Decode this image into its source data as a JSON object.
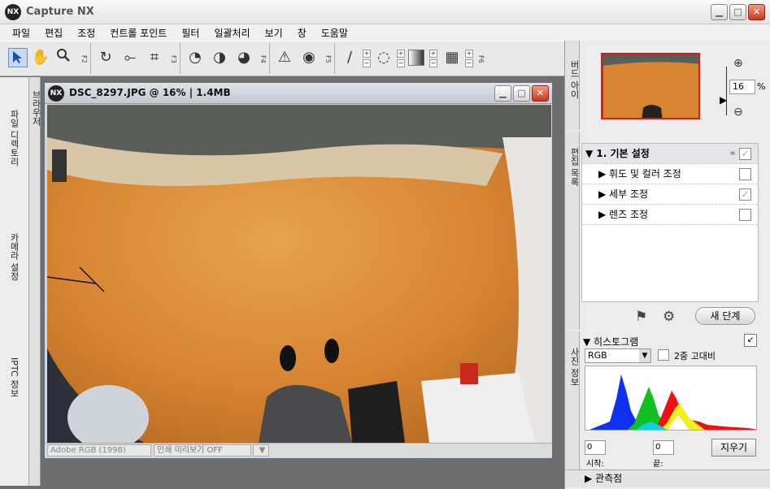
{
  "app": {
    "logo": "NX",
    "title": "Capture NX"
  },
  "menu": [
    "파일",
    "편집",
    "조정",
    "컨트롤 포인트",
    "필터",
    "일괄처리",
    "보기",
    "창",
    "도움말"
  ],
  "toolbar": {
    "f2": "F2",
    "f3": "F3",
    "f4": "F4",
    "f5": "F5",
    "f6": "F6",
    "plus": "+",
    "minus": "−"
  },
  "left_panels": [
    "브라우저",
    "파일 디렉토리",
    "카메라 설정",
    "IPTC 정보"
  ],
  "document": {
    "title": "DSC_8297.JPG @ 16% | 1.4MB",
    "color_space": "Adobe RGB (1998)",
    "print_preview": "인쇄 미리보기 OFF"
  },
  "navigator": {
    "panel_label": "버드 아이",
    "zoom_value": "16",
    "zoom_unit": "%"
  },
  "edit_list": {
    "panel_label": "편집 목록",
    "section_title": "1. 기본 설정",
    "items": [
      {
        "label": "휘도 및 컬러 조정",
        "checked": false
      },
      {
        "label": "세부 조정",
        "checked": true
      },
      {
        "label": "렌즈 조정",
        "checked": false
      }
    ],
    "new_step": "새 단계"
  },
  "histogram": {
    "panel_label": "사진 정보",
    "title": "히스토그램",
    "channel": "RGB",
    "double_threshold": "2중 고대비",
    "start_label": "시작:",
    "end_label": "끝:",
    "start_value": "0",
    "end_value": "0",
    "clear_button": "지우기"
  },
  "watch_points": {
    "title": "관측점"
  },
  "colors": {
    "accent_red": "#d62020",
    "selection_blue": "#6a8cc8"
  }
}
